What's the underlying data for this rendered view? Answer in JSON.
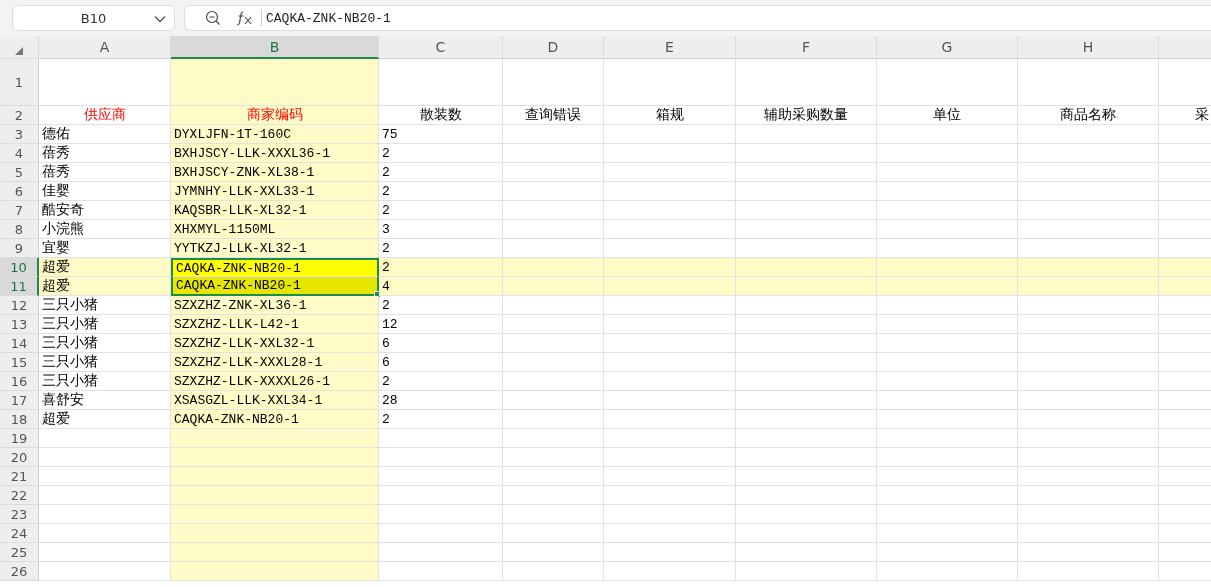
{
  "name_box": {
    "value": "B10"
  },
  "formula_bar": {
    "value": "CAQKA-ZNK-NB20-1"
  },
  "columns": [
    {
      "label": "A",
      "selected": false
    },
    {
      "label": "B",
      "selected": true
    },
    {
      "label": "C",
      "selected": false
    },
    {
      "label": "D",
      "selected": false
    },
    {
      "label": "E",
      "selected": false
    },
    {
      "label": "F",
      "selected": false
    },
    {
      "label": "G",
      "selected": false
    },
    {
      "label": "H",
      "selected": false
    }
  ],
  "first_row": {
    "number": "1"
  },
  "header_row": {
    "number": "2",
    "cells": [
      {
        "text": "供应商",
        "highlighted": true
      },
      {
        "text": "商家编码",
        "highlighted": true
      },
      {
        "text": "散装数",
        "highlighted": false
      },
      {
        "text": "查询错误",
        "highlighted": false
      },
      {
        "text": "箱规",
        "highlighted": false
      },
      {
        "text": "辅助采购数量",
        "highlighted": false
      },
      {
        "text": "单位",
        "highlighted": false
      },
      {
        "text": "商品名称",
        "highlighted": false
      },
      {
        "text": "采",
        "highlighted": false
      }
    ]
  },
  "rows": [
    {
      "number": "3",
      "selected": false,
      "cells": [
        "德佑",
        "DYXLJFN-1T-160C",
        "75"
      ]
    },
    {
      "number": "4",
      "selected": false,
      "cells": [
        "蓓秀",
        "BXHJSCY-LLK-XXXL36-1",
        "2"
      ]
    },
    {
      "number": "5",
      "selected": false,
      "cells": [
        "蓓秀",
        "BXHJSCY-ZNK-XL38-1",
        "2"
      ]
    },
    {
      "number": "6",
      "selected": false,
      "cells": [
        "佳婴",
        "JYMNHY-LLK-XXL33-1",
        "2"
      ]
    },
    {
      "number": "7",
      "selected": false,
      "cells": [
        "酷安奇",
        "KAQSBR-LLK-XL32-1",
        "2"
      ]
    },
    {
      "number": "8",
      "selected": false,
      "cells": [
        "小浣熊",
        "XHXMYL-1150ML",
        "3"
      ]
    },
    {
      "number": "9",
      "selected": false,
      "cells": [
        "宜婴",
        "YYTKZJ-LLK-XL32-1",
        "2"
      ]
    },
    {
      "number": "10",
      "selected": true,
      "cells": [
        "超爱",
        "CAQKA-ZNK-NB20-1",
        "2"
      ]
    },
    {
      "number": "11",
      "selected": true,
      "cells": [
        "超爱",
        "CAQKA-ZNK-NB20-1",
        "4"
      ]
    },
    {
      "number": "12",
      "selected": false,
      "cells": [
        "三只小猪",
        "SZXZHZ-ZNK-XL36-1",
        "2"
      ]
    },
    {
      "number": "13",
      "selected": false,
      "cells": [
        "三只小猪",
        "SZXZHZ-LLK-L42-1",
        "12"
      ]
    },
    {
      "number": "14",
      "selected": false,
      "cells": [
        "三只小猪",
        "SZXZHZ-LLK-XXL32-1",
        "6"
      ]
    },
    {
      "number": "15",
      "selected": false,
      "cells": [
        "三只小猪",
        "SZXZHZ-LLK-XXXL28-1",
        "6"
      ]
    },
    {
      "number": "16",
      "selected": false,
      "cells": [
        "三只小猪",
        "SZXZHZ-LLK-XXXXL26-1",
        "2"
      ]
    },
    {
      "number": "17",
      "selected": false,
      "cells": [
        "喜舒安",
        "XSASGZL-LLK-XXL34-1",
        "28"
      ]
    },
    {
      "number": "18",
      "selected": false,
      "cells": [
        "超爱",
        "CAQKA-ZNK-NB20-1",
        "2"
      ]
    }
  ],
  "empty_rows": [
    "19",
    "20",
    "21",
    "22",
    "23",
    "24",
    "25",
    "26"
  ]
}
